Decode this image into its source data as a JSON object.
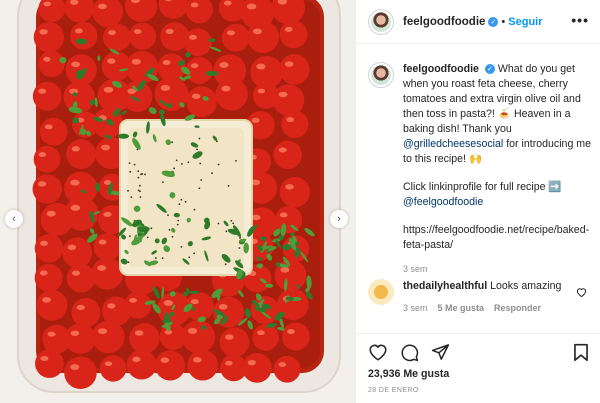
{
  "colors": {
    "link": "#0095f6",
    "mention": "#00376b",
    "verified": "#3897f0",
    "muted": "#8e8e8e",
    "tomato": "#d9241a",
    "basil": "#2f7a2a"
  },
  "media": {
    "prev_icon": "chevron-left-icon",
    "next_icon": "chevron-right-icon"
  },
  "header": {
    "username": "feelgoodfoodie",
    "separator": "•",
    "follow_label": "Seguir",
    "more_label": "•••"
  },
  "caption": {
    "username": "feelgoodfoodie",
    "line1": "What do you get when you roast feta cheese, cherry tomatoes and extra virgin olive oil and then toss in pasta?! 🍝 Heaven in a baking dish! Thank you ",
    "mention": "@grilledcheesesocial",
    "line1_end": " for introducing me to this recipe! 🙌",
    "line2": "Click linkinprofile for full recipe ➡️ ",
    "mention2": "@feelgoodfoodie",
    "url": "https://feelgoodfoodie.net/recipe/baked-feta-pasta/",
    "time": "3 sem"
  },
  "comment": {
    "username": "thedailyhealthful",
    "text": "Looks amazing",
    "time": "3 sem",
    "likes": "5 Me gusta",
    "reply": "Responder"
  },
  "actions": {
    "likes": "23,936 Me gusta",
    "date": "28 DE ENERO"
  }
}
